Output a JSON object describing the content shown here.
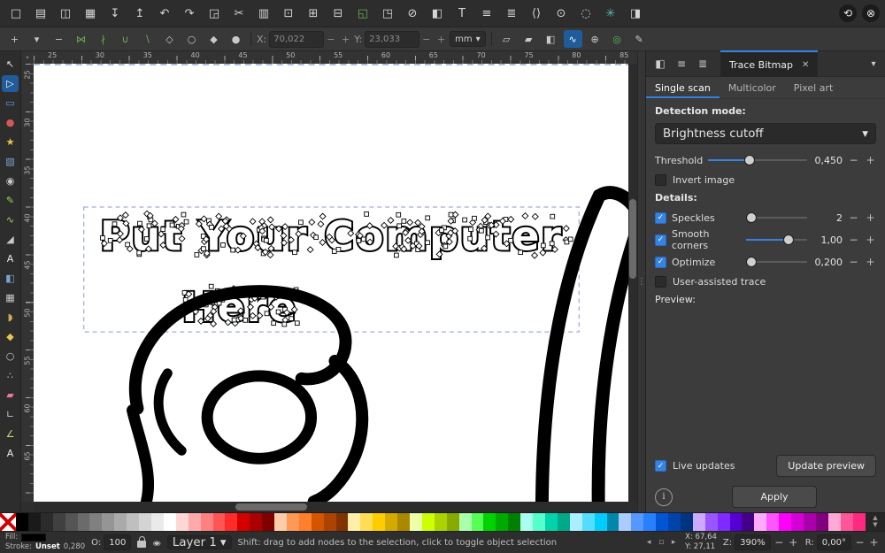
{
  "accent": "#3584e4",
  "toolbar_main": {
    "items": [
      {
        "name": "new-document-icon",
        "g": "□"
      },
      {
        "name": "open-document-icon",
        "g": "▤"
      },
      {
        "name": "save-icon",
        "g": "◫"
      },
      {
        "name": "print-icon",
        "g": "▦"
      },
      {
        "name": "import-icon",
        "g": "↧"
      },
      {
        "name": "export-icon",
        "g": "↥"
      },
      {
        "name": "undo-icon",
        "g": "↶"
      },
      {
        "name": "redo-icon",
        "g": "↷"
      },
      {
        "name": "copy-icon",
        "g": "◲"
      },
      {
        "name": "cut-icon",
        "g": "✂"
      },
      {
        "name": "paste-icon",
        "g": "▥"
      },
      {
        "name": "zoom-selection-icon",
        "g": "⊡"
      },
      {
        "name": "zoom-drawing-icon",
        "g": "⊞"
      },
      {
        "name": "zoom-page-icon",
        "g": "⊟"
      },
      {
        "name": "duplicate-icon",
        "g": "◱",
        "c": "#6ab04c"
      },
      {
        "name": "clone-icon",
        "g": "◳"
      },
      {
        "name": "unlink-clone-icon",
        "g": "⊘"
      },
      {
        "name": "fill-stroke-dialog-icon",
        "g": "◧"
      },
      {
        "name": "text-dialog-icon",
        "g": "T"
      },
      {
        "name": "align-distribute-dialog-icon",
        "g": "≡"
      },
      {
        "name": "layers-dialog-icon",
        "g": "≣"
      },
      {
        "name": "xml-editor-icon",
        "g": "⟨⟩"
      },
      {
        "name": "objects-dialog-icon",
        "g": "⊙"
      },
      {
        "name": "find-replace-icon",
        "g": "◌"
      },
      {
        "name": "symbols-dialog-icon",
        "g": "✳",
        "c": "#5ab9b9"
      },
      {
        "name": "document-properties-icon",
        "g": "◨"
      }
    ],
    "right_items": [
      {
        "name": "undo-history-icon",
        "g": "⟲"
      },
      {
        "name": "snap-toggle-icon",
        "g": "⊗"
      }
    ]
  },
  "tool_controls": {
    "left_icons": [
      {
        "name": "insert-node-icon",
        "g": "+"
      },
      {
        "name": "insert-node-menu-icon",
        "g": "▾"
      },
      {
        "name": "delete-node-icon",
        "g": "−"
      },
      {
        "name": "join-nodes-icon",
        "g": "⋈",
        "c": "#6ab04c"
      },
      {
        "name": "break-nodes-icon",
        "g": "∤",
        "c": "#6ab04c"
      },
      {
        "name": "join-with-segment-icon",
        "g": "∪",
        "c": "#6ab04c"
      },
      {
        "name": "delete-segment-icon",
        "g": "∖",
        "c": "#6ab04c"
      },
      {
        "name": "node-corner-icon",
        "g": "◇"
      },
      {
        "name": "node-smooth-icon",
        "g": "○"
      },
      {
        "name": "node-symmetric-icon",
        "g": "◆"
      },
      {
        "name": "node-auto-icon",
        "g": "●"
      }
    ],
    "x_label": "X:",
    "x_value": "70,022",
    "y_label": "Y:",
    "y_value": "23,033",
    "unit": "mm",
    "right_icons": [
      {
        "name": "object-to-path-icon",
        "g": "▱"
      },
      {
        "name": "stroke-to-path-icon",
        "g": "▰"
      },
      {
        "name": "show-clip-icon",
        "g": "◧"
      },
      {
        "name": "show-bezier-handles-icon",
        "g": "∿",
        "active": true
      },
      {
        "name": "show-transform-handles-icon",
        "g": "⊕"
      },
      {
        "name": "snap-nodes-icon",
        "g": "◎",
        "c": "#5ab95a"
      },
      {
        "name": "edit-mask-icon",
        "g": "✎"
      }
    ]
  },
  "tools_left": [
    {
      "name": "selector-tool",
      "g": "↖",
      "c": "#e6e6e6"
    },
    {
      "name": "node-tool",
      "g": "▷",
      "c": "#ffffff",
      "active": true
    },
    {
      "name": "rectangle-tool",
      "g": "▭",
      "c": "#6a9fd8"
    },
    {
      "name": "ellipse-tool",
      "g": "●",
      "c": "#d45a5a"
    },
    {
      "name": "star-tool",
      "g": "★",
      "c": "#e8c84a"
    },
    {
      "name": "box3d-tool",
      "g": "▧",
      "c": "#7aa3d4"
    },
    {
      "name": "spiral-tool",
      "g": "◉",
      "c": "#c9c9c9"
    },
    {
      "name": "pencil-tool",
      "g": "✎",
      "c": "#9ad45a"
    },
    {
      "name": "bezier-tool",
      "g": "∿",
      "c": "#9ad45a"
    },
    {
      "name": "calligraphy-tool",
      "g": "◢",
      "c": "#c9c9c9"
    },
    {
      "name": "text-tool",
      "g": "A",
      "c": "#ececec"
    },
    {
      "name": "gradient-tool",
      "g": "◧",
      "c": "#7aa3d4"
    },
    {
      "name": "mesh-tool",
      "g": "▦",
      "c": "#c9c9c9"
    },
    {
      "name": "dropper-tool",
      "g": "◗",
      "c": "#d4aa55"
    },
    {
      "name": "bucket-tool",
      "g": "◆",
      "c": "#e8c84a"
    },
    {
      "name": "tweak-tool",
      "g": "○",
      "c": "#c9c9c9"
    },
    {
      "name": "spray-tool",
      "g": "∴",
      "c": "#c9c9c9"
    },
    {
      "name": "eraser-tool",
      "g": "▰",
      "c": "#e87aa3"
    },
    {
      "name": "connector-tool",
      "g": "∟",
      "c": "#c9c9c9"
    },
    {
      "name": "measure-tool",
      "g": "∠",
      "c": "#d4d46a"
    },
    {
      "name": "pages-tool",
      "g": "A",
      "c": "#ececec"
    }
  ],
  "rulers": {
    "h": [
      "25",
      "30",
      "35",
      "40",
      "45",
      "50",
      "55",
      "60",
      "65",
      "70",
      "75",
      "80",
      "85"
    ],
    "v": [
      "25",
      "30",
      "35",
      "40",
      "45",
      "50",
      "55",
      "60",
      "65"
    ]
  },
  "canvas": {
    "text_line1": "Put Your Computer",
    "text_line2": "Here"
  },
  "panel": {
    "header_icons": [
      {
        "name": "fill-stroke-tab-icon",
        "g": "◧"
      },
      {
        "name": "align-tab-icon",
        "g": "≡"
      },
      {
        "name": "objects-tab-icon",
        "g": "≣"
      }
    ],
    "tab_title": "Trace Bitmap",
    "tabs": [
      {
        "label": "Single scan",
        "active": true
      },
      {
        "label": "Multicolor",
        "active": false
      },
      {
        "label": "Pixel art",
        "active": false
      }
    ],
    "detection_label": "Detection mode:",
    "detection_value": "Brightness cutoff",
    "threshold": {
      "label": "Threshold",
      "value": "0,450",
      "pct": 42
    },
    "invert": {
      "label": "Invert image",
      "checked": false
    },
    "details_label": "Details:",
    "speckles": {
      "label": "Speckles",
      "value": "2",
      "pct": 8,
      "checked": true
    },
    "smooth": {
      "label": "Smooth corners",
      "value": "1,00",
      "pct": 70,
      "checked": true
    },
    "optimize": {
      "label": "Optimize",
      "value": "0,200",
      "pct": 8,
      "checked": true
    },
    "user_assisted": {
      "label": "User-assisted trace",
      "checked": false
    },
    "preview_label": "Preview:",
    "live_updates": {
      "label": "Live updates",
      "checked": true
    },
    "update_preview_label": "Update preview",
    "apply_label": "Apply"
  },
  "palette": {
    "colors": [
      "#000000",
      "#1a1a1a",
      "#2b2b2b",
      "#404040",
      "#555555",
      "#6b6b6b",
      "#808080",
      "#959595",
      "#aaaaaa",
      "#bfbfbf",
      "#d4d4d4",
      "#eaeaea",
      "#ffffff",
      "#ffd5d5",
      "#ffaaaa",
      "#ff8080",
      "#ff5555",
      "#ff2a2a",
      "#d40000",
      "#aa0000",
      "#800000",
      "#ffccaa",
      "#ff9955",
      "#ff7f2a",
      "#d45500",
      "#aa4400",
      "#803300",
      "#ffeeaa",
      "#ffdd55",
      "#ffcc00",
      "#d4aa00",
      "#aa8800",
      "#eeffaa",
      "#ccff00",
      "#aad400",
      "#88aa00",
      "#aaffaa",
      "#55ff55",
      "#00d400",
      "#00aa00",
      "#008000",
      "#aaffee",
      "#55ffcc",
      "#00d4aa",
      "#00aa88",
      "#aaeeff",
      "#55ddff",
      "#00ccff",
      "#0088aa",
      "#aaccff",
      "#5599ff",
      "#2a7fff",
      "#0055d4",
      "#0044aa",
      "#003380",
      "#ccaaff",
      "#9955ff",
      "#7f2aff",
      "#5500d4",
      "#440088",
      "#ffaaff",
      "#ff55ff",
      "#ff00ff",
      "#d400d4",
      "#aa00aa",
      "#800080",
      "#ffaad4",
      "#ff5599",
      "#ff2a7f"
    ]
  },
  "statusbar": {
    "fill_label": "Fill:",
    "stroke_label": "Stroke:",
    "stroke_value": "Unset",
    "stroke_width": "0,280",
    "opacity_label": "O:",
    "opacity_value": "100",
    "layer_label": "Layer 1",
    "message": "Shift: drag to add nodes to the selection, click to toggle object selection",
    "nav": [
      {
        "name": "scroll-left-icon",
        "g": "◂"
      },
      {
        "name": "center-view-icon",
        "g": "▫"
      },
      {
        "name": "scroll-right-icon",
        "g": "▸"
      }
    ],
    "x_label": "X:",
    "x_value": "67,64",
    "y_label": "Y:",
    "y_value": "27,11",
    "zoom_label": "Z:",
    "zoom_value": "390%",
    "rotation_label": "R:",
    "rotation_value": "0,00°"
  }
}
